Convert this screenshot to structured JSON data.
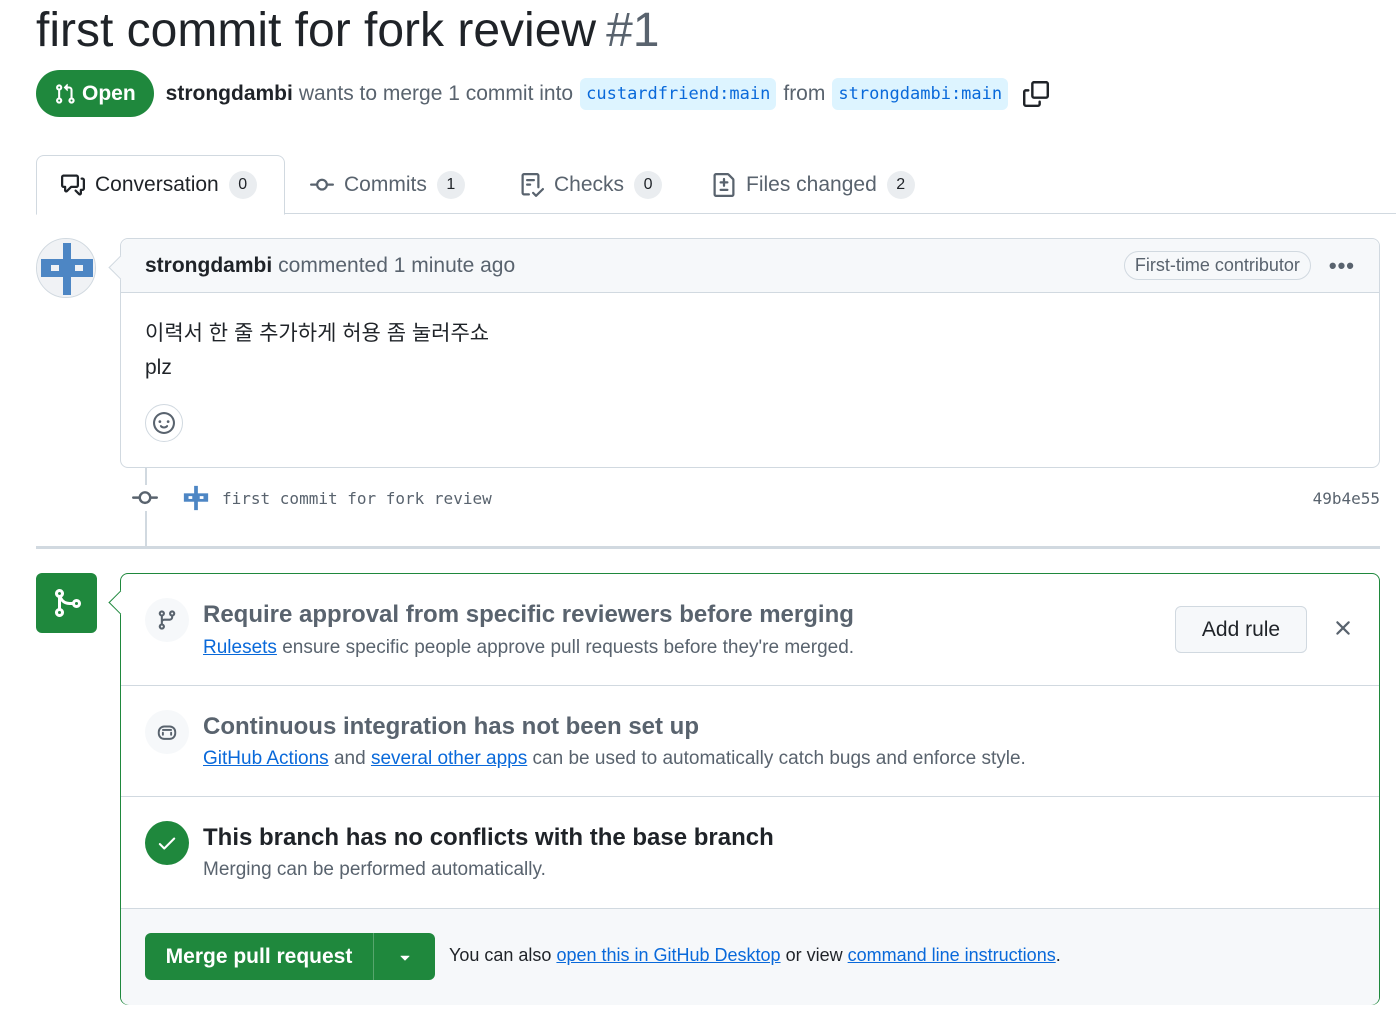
{
  "header": {
    "title": "first commit for fork review",
    "number": "#1",
    "state": "Open",
    "author": "strongdambi",
    "merge_text": "wants to merge 1 commit into",
    "base_branch": "custardfriend:main",
    "from_text": "from",
    "head_branch": "strongdambi:main"
  },
  "tabs": [
    {
      "label": "Conversation",
      "count": "0"
    },
    {
      "label": "Commits",
      "count": "1"
    },
    {
      "label": "Checks",
      "count": "0"
    },
    {
      "label": "Files changed",
      "count": "2"
    }
  ],
  "comment": {
    "author": "strongdambi",
    "action": "commented 1 minute ago",
    "badge": "First-time contributor",
    "body_line1": "이력서 한 줄 추가하게 허용 좀 눌러주쇼",
    "body_line2": "plz"
  },
  "commit": {
    "message": "first commit for fork review",
    "sha": "49b4e55"
  },
  "merge_box": {
    "rules": {
      "title": "Require approval from specific reviewers before merging",
      "link": "Rulesets",
      "desc": "ensure specific people approve pull requests before they're merged.",
      "button": "Add rule"
    },
    "ci": {
      "title": "Continuous integration has not been set up",
      "link1": "GitHub Actions",
      "and": "and",
      "link2": "several other apps",
      "desc": "can be used to automatically catch bugs and enforce style."
    },
    "conflicts": {
      "title": "This branch has no conflicts with the base branch",
      "desc": "Merging can be performed automatically."
    },
    "footer": {
      "button": "Merge pull request",
      "text1": "You can also",
      "link1": "open this in GitHub Desktop",
      "text2": "or view",
      "link2": "command line instructions",
      "text3": "."
    }
  },
  "colors": {
    "green": "#1f883d",
    "link": "#0969da",
    "muted": "#59636e",
    "border": "#d1d9e0"
  }
}
